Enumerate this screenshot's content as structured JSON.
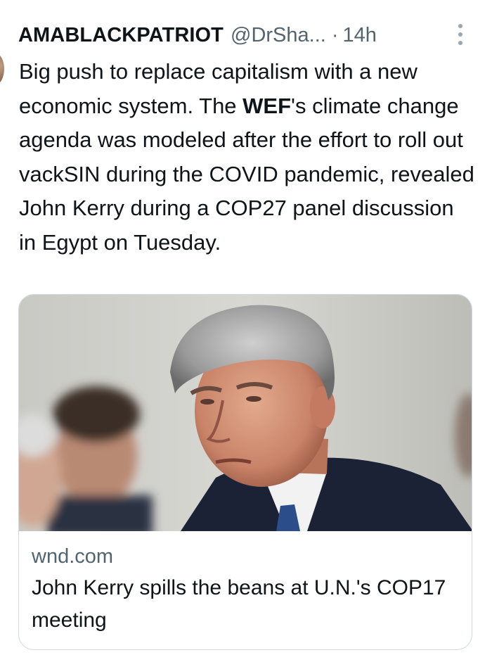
{
  "tweet": {
    "display_name": "AMABLACKPATRIOT",
    "handle": "@DrSha...",
    "separator": "·",
    "time": "14h",
    "text_parts": [
      "Big push to replace capitalism with a new economic system. The ",
      "WEF",
      "'s climate change agenda was modeled after the effort to roll out vackSIN during the COVID pandemic, revealed John Kerry during a COP27 panel discussion in Egypt on Tuesday."
    ]
  },
  "card": {
    "domain": "wnd.com",
    "title": "John Kerry spills the beans at U.N.'s COP17 meeting"
  },
  "icons": {
    "more": "more-vertical-icon"
  },
  "colors": {
    "text_primary": "#0f1419",
    "text_secondary": "#536471",
    "border": "#cfd9de"
  }
}
